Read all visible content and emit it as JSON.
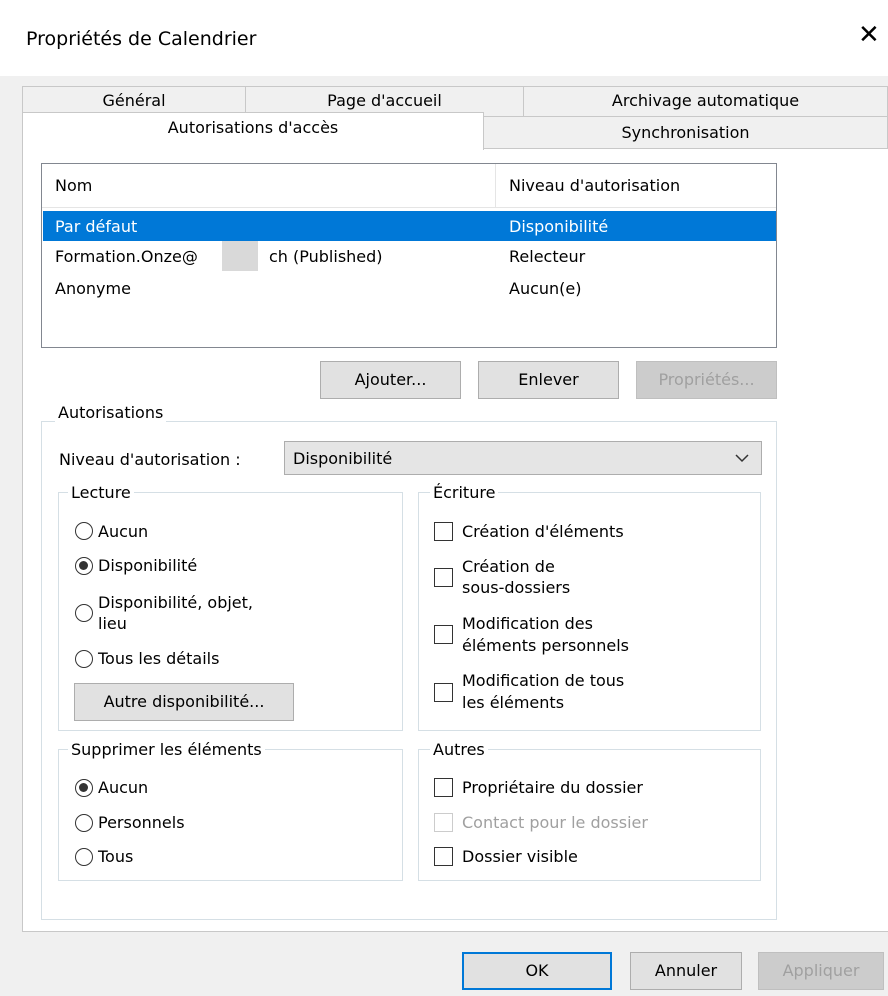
{
  "window": {
    "title": "Propriétés de Calendrier"
  },
  "tabs": [
    {
      "label": "Général"
    },
    {
      "label": "Page d'accueil"
    },
    {
      "label": "Archivage automatique"
    },
    {
      "label": "Autorisations d'accès",
      "active": true
    },
    {
      "label": "Synchronisation"
    }
  ],
  "permissions_list": {
    "columns": [
      "Nom",
      "Niveau d'autorisation"
    ],
    "rows": [
      {
        "name": "Par défaut",
        "level": "Disponibilité",
        "selected": true
      },
      {
        "name": "Formation.Onze@",
        "name_suffix": "ch (Published)",
        "level": "Relecteur"
      },
      {
        "name": "Anonyme",
        "level": "Aucun(e)"
      }
    ]
  },
  "list_buttons": {
    "add": "Ajouter...",
    "remove": "Enlever",
    "properties": "Propriétés..."
  },
  "authorizations": {
    "group_label": "Autorisations",
    "level_label": "Niveau d'autorisation :",
    "level_value": "Disponibilité",
    "read": {
      "label": "Lecture",
      "options": [
        "Aucun",
        "Disponibilité",
        "Disponibilité, objet,",
        "lieu",
        "Tous les détails"
      ],
      "selected": "Disponibilité",
      "other_button": "Autre disponibilité..."
    },
    "write": {
      "label": "Écriture",
      "create_items": "Création d'éléments",
      "create_subfolders_1": "Création de",
      "create_subfolders_2": "sous-dossiers",
      "edit_own_1": "Modification des",
      "edit_own_2": "éléments personnels",
      "edit_all_1": "Modification de tous",
      "edit_all_2": "les éléments"
    },
    "delete": {
      "label": "Supprimer les éléments",
      "options": [
        "Aucun",
        "Personnels",
        "Tous"
      ],
      "selected": "Aucun"
    },
    "other": {
      "label": "Autres",
      "owner": "Propriétaire du dossier",
      "contact": "Contact pour le dossier",
      "visible": "Dossier visible"
    }
  },
  "footer": {
    "ok": "OK",
    "cancel": "Annuler",
    "apply": "Appliquer"
  },
  "colors": {
    "selection": "#0078d7",
    "window_bg": "#f0f0f0",
    "panel_bg": "#ffffff"
  }
}
